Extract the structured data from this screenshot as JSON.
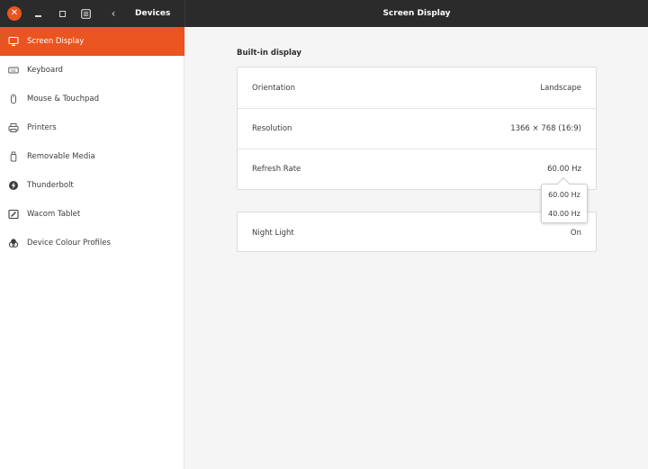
{
  "window": {
    "close_glyph": "✕",
    "back_glyph": "‹",
    "sidebar_title": "Devices",
    "page_title": "Screen Display",
    "accent_color": "#e95420",
    "header_color": "#2b2b2b"
  },
  "sidebar": {
    "items": [
      {
        "label": "Screen Display",
        "icon": "display-icon",
        "active": true
      },
      {
        "label": "Keyboard",
        "icon": "keyboard-icon"
      },
      {
        "label": "Mouse & Touchpad",
        "icon": "mouse-icon"
      },
      {
        "label": "Printers",
        "icon": "printer-icon"
      },
      {
        "label": "Removable Media",
        "icon": "removable-media-icon"
      },
      {
        "label": "Thunderbolt",
        "icon": "thunderbolt-icon"
      },
      {
        "label": "Wacom Tablet",
        "icon": "tablet-icon"
      },
      {
        "label": "Device Colour Profiles",
        "icon": "colour-profile-icon"
      }
    ]
  },
  "main": {
    "section_heading": "Built-in display",
    "display_rows": [
      {
        "label": "Orientation",
        "value": "Landscape"
      },
      {
        "label": "Resolution",
        "value": "1366 × 768 (16:9)"
      },
      {
        "label": "Refresh Rate",
        "value": "60.00 Hz"
      }
    ],
    "night_light": {
      "label": "Night Light",
      "value": "On"
    }
  },
  "refresh_dropdown": {
    "options": [
      "60.00 Hz",
      "40.00 Hz"
    ]
  }
}
